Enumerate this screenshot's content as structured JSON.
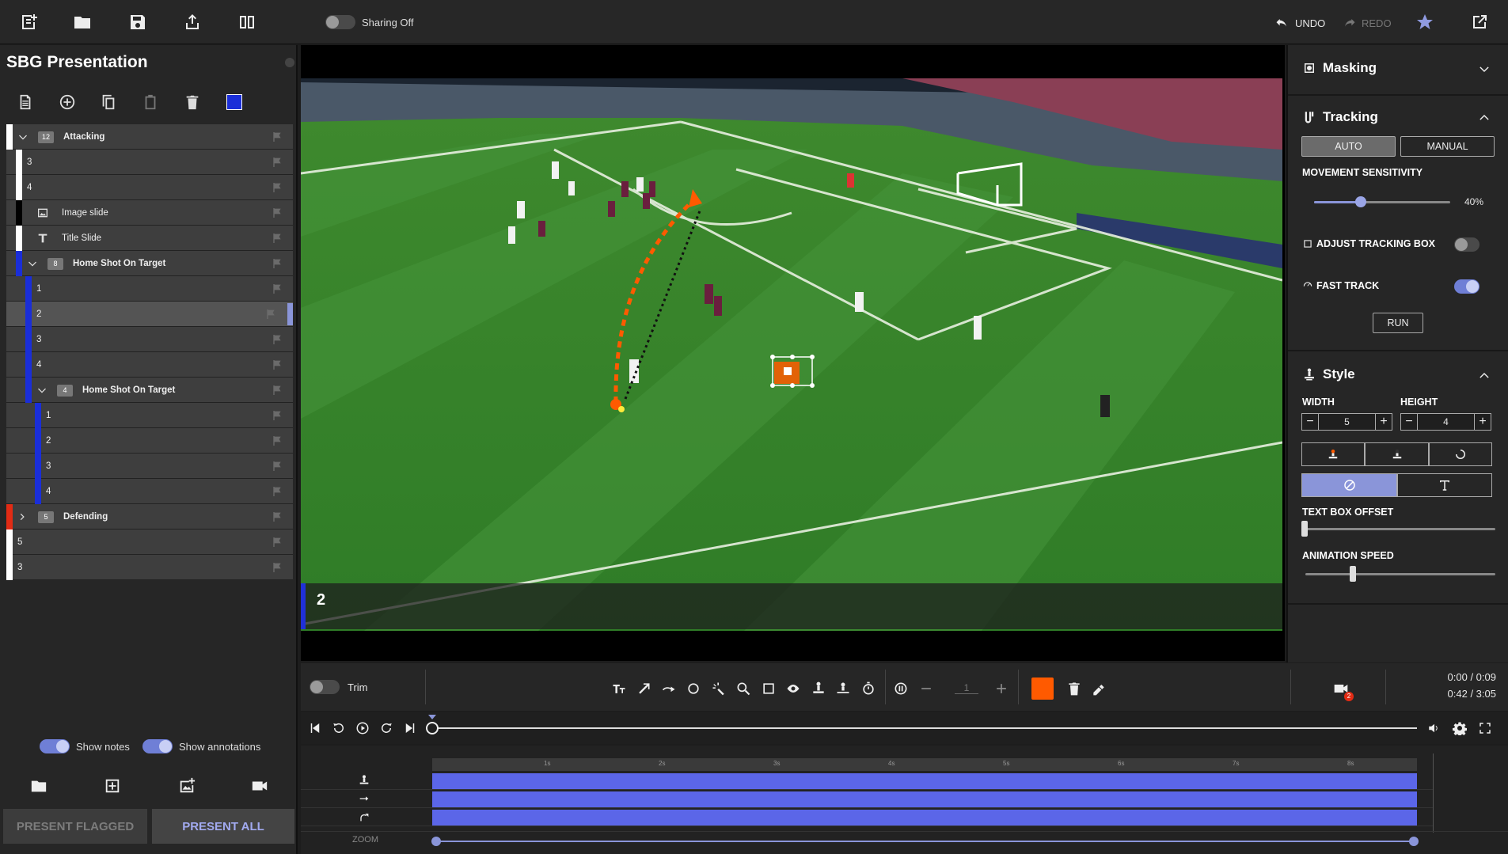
{
  "topbar": {
    "sharing_label": "Sharing Off",
    "undo_label": "UNDO",
    "redo_label": "REDO"
  },
  "left": {
    "title": "SBG Presentation",
    "rows": [
      {
        "label": "Attacking",
        "badge": "12",
        "kind": "group",
        "color": "#ffffff"
      },
      {
        "label": "3",
        "kind": "item",
        "color": "#ffffff"
      },
      {
        "label": "4",
        "kind": "item",
        "color": "#ffffff"
      },
      {
        "label": "Image slide",
        "kind": "image",
        "color": "#000000"
      },
      {
        "label": "Title Slide",
        "kind": "title",
        "color": "#ffffff"
      },
      {
        "label": "Home Shot On Target",
        "badge": "8",
        "kind": "group",
        "color": "#1a2ed8"
      },
      {
        "label": "1",
        "kind": "item",
        "color": "#1a2ed8"
      },
      {
        "label": "2",
        "kind": "item",
        "color": "#1a2ed8",
        "selected": true
      },
      {
        "label": "3",
        "kind": "item",
        "color": "#1a2ed8"
      },
      {
        "label": "4",
        "kind": "item",
        "color": "#1a2ed8"
      },
      {
        "label": "Home Shot On Target",
        "badge": "4",
        "kind": "group",
        "color": "#1a2ed8"
      },
      {
        "label": "1",
        "kind": "item",
        "color": "#1a2ed8"
      },
      {
        "label": "2",
        "kind": "item",
        "color": "#1a2ed8"
      },
      {
        "label": "3",
        "kind": "item",
        "color": "#1a2ed8"
      },
      {
        "label": "4",
        "kind": "item",
        "color": "#1a2ed8"
      },
      {
        "label": "Defending",
        "badge": "5",
        "kind": "group",
        "color": "#e22b14"
      },
      {
        "label": "5",
        "kind": "item",
        "color": "#ffffff"
      },
      {
        "label": "3",
        "kind": "item",
        "color": "#ffffff"
      }
    ],
    "show_notes": "Show notes",
    "show_annotations": "Show annotations",
    "present_flagged": "PRESENT FLAGGED",
    "present_all": "PRESENT ALL"
  },
  "video": {
    "caption": "2"
  },
  "right": {
    "masking": "Masking",
    "tracking": "Tracking",
    "auto": "AUTO",
    "manual": "MANUAL",
    "movement_sensitivity": "MOVEMENT SENSITIVITY",
    "sensitivity_value": "40%",
    "adjust_tracking_box": "ADJUST TRACKING BOX",
    "fast_track": "FAST TRACK",
    "run": "RUN",
    "style": "Style",
    "width_label": "WIDTH",
    "height_label": "HEIGHT",
    "width_value": "5",
    "height_value": "4",
    "text_box_offset": "TEXT BOX OFFSET",
    "animation_speed": "ANIMATION SPEED",
    "accent": "#8a95d9"
  },
  "toolbar": {
    "trim_label": "Trim",
    "step_value": "1",
    "color": "#ff5a00",
    "camera_badge": "2",
    "time_current": "0:00 / 0:09",
    "time_total": "0:42 / 3:05"
  },
  "timeline": {
    "ticks": [
      "1s",
      "2s",
      "3s",
      "4s",
      "5s",
      "6s",
      "7s",
      "8s"
    ],
    "zoom_label": "ZOOM"
  }
}
